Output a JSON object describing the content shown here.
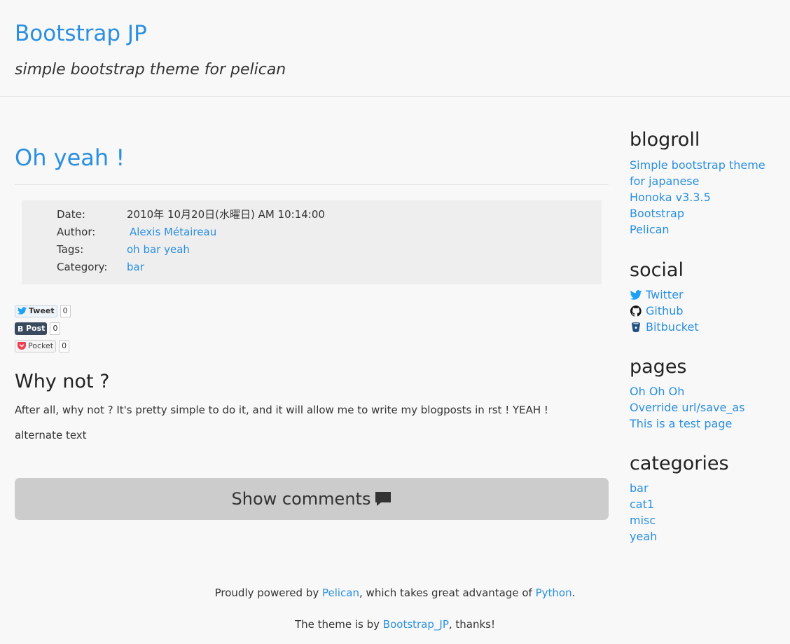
{
  "header": {
    "title": "Bootstrap JP",
    "subtitle": "simple bootstrap theme for pelican"
  },
  "article": {
    "title": "Oh yeah !",
    "meta": {
      "date_label": "Date:",
      "date_value": "2010年 10月20日(水曜日) AM 10:14:00",
      "author_label": "Author:",
      "author_value": "Alexis Métaireau",
      "tags_label": "Tags:",
      "tags_value": "oh bar yeah",
      "category_label": "Category:",
      "category_value": "bar"
    },
    "share": {
      "tweet_label": "Tweet",
      "tweet_count": "0",
      "post_label": "Post",
      "post_count": "0",
      "pocket_label": "Pocket",
      "pocket_count": "0"
    },
    "heading": "Why not ?",
    "paragraph": "After all, why not ? It's pretty simple to do it, and it will allow me to write my blogposts in rst ! YEAH !",
    "alt_text": "alternate text",
    "comments_button": "Show comments"
  },
  "sidebar": {
    "blogroll": {
      "title": "blogroll",
      "items": [
        "Simple bootstrap theme for japanese",
        "Honoka v3.3.5",
        "Bootstrap",
        "Pelican"
      ]
    },
    "social": {
      "title": "social",
      "items": [
        {
          "label": "Twitter",
          "icon": "twitter-icon"
        },
        {
          "label": "Github",
          "icon": "github-icon"
        },
        {
          "label": "Bitbucket",
          "icon": "bitbucket-icon"
        }
      ]
    },
    "pages": {
      "title": "pages",
      "items": [
        "Oh Oh Oh",
        "Override url/save_as",
        "This is a test page"
      ]
    },
    "categories": {
      "title": "categories",
      "items": [
        "bar",
        "cat1",
        "misc",
        "yeah"
      ]
    }
  },
  "footer": {
    "line1_pre": "Proudly powered by ",
    "line1_link1": "Pelican",
    "line1_mid": ", which takes great advantage of ",
    "line1_link2": "Python",
    "line1_post": ".",
    "line2_pre": "The theme is by ",
    "line2_link": "Bootstrap_JP",
    "line2_post": ", thanks!"
  },
  "colors": {
    "link": "#2a8fe0",
    "background": "#f8f8f8",
    "meta_box": "#eeeeee",
    "comments_button": "#cccccc"
  }
}
